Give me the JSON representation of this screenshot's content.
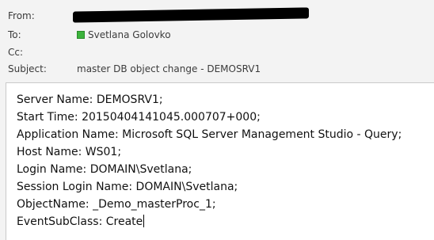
{
  "header": {
    "from_label": "From:",
    "to_label": "To:",
    "to_value": "Svetlana Golovko",
    "cc_label": "Cc:",
    "subject_label": "Subject:",
    "subject_value": "master DB object change - DEMOSRV1"
  },
  "body": {
    "lines": [
      "Server Name: DEMOSRV1;",
      "Start Time: 20150404141045.000707+000;",
      "Application Name: Microsoft SQL Server Management Studio - Query;",
      "Host Name: WS01;",
      "Login Name: DOMAIN\\Svetlana;",
      "Session Login Name: DOMAIN\\Svetlana;",
      "ObjectName: _Demo_masterProc_1;",
      "EventSubClass: Create"
    ]
  },
  "colors": {
    "presence": "#3cb33c",
    "header_bg": "#f3f3f3",
    "body_bg": "#ffffff"
  }
}
